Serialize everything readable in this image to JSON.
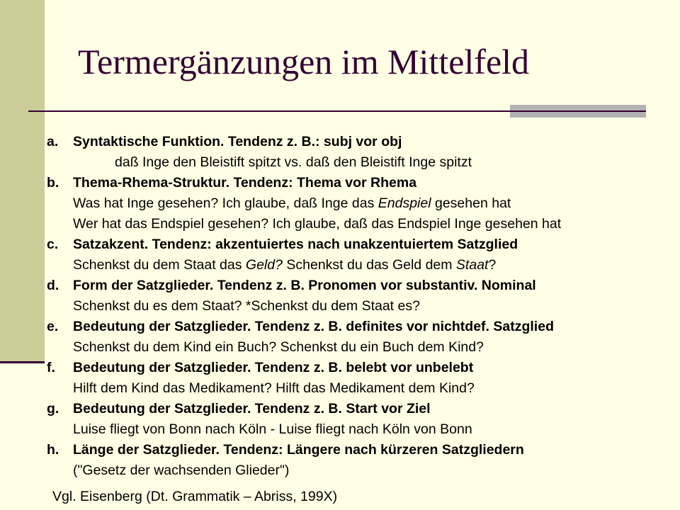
{
  "title": "Termergänzungen im Mittelfeld",
  "items": [
    {
      "letter": "a.",
      "heading": "Syntaktische Funktion. Tendenz z. B.: subj vor obj",
      "examples": [
        {
          "text": "daß Inge den Bleistift spitzt vs. daß den Bleistift Inge spitzt",
          "indent": "deep"
        }
      ]
    },
    {
      "letter": "b.",
      "heading": "Thema-Rhema-Struktur. Tendenz: Thema vor Rhema",
      "examples": [
        {
          "text": "Was hat Inge gesehen? Ich glaube, daß Inge das ",
          "em": "Endspiel",
          "after": " gesehen hat"
        },
        {
          "text": "Wer hat das Endspiel gesehen? Ich glaube, daß das Endspiel Inge gesehen hat"
        }
      ]
    },
    {
      "letter": "c.",
      "heading": "Satzakzent. Tendenz: akzentuiertes nach unakzentuiertem Satzglied",
      "examples": [
        {
          "text": "Schenkst du dem Staat das ",
          "em": "Geld?",
          "after": " Schenkst du das Geld dem ",
          "em2": "Staat",
          "after2": "?"
        }
      ]
    },
    {
      "letter": "d.",
      "heading": "Form der Satzglieder. Tendenz z. B. Pronomen vor substantiv. Nominal",
      "examples": [
        {
          "text": "Schenkst du es dem Staat? *Schenkst du dem Staat es?"
        }
      ]
    },
    {
      "letter": "e.",
      "heading": "Bedeutung der Satzglieder. Tendenz z. B. definites vor nichtdef. Satzglied",
      "examples": [
        {
          "text": "Schenkst du dem Kind ein Buch? Schenkst du ein Buch dem Kind?"
        }
      ]
    },
    {
      "letter": "f.",
      "heading": "Bedeutung der Satzglieder. Tendenz z. B. belebt vor unbelebt",
      "examples": [
        {
          "text": "Hilft dem Kind das Medikament? Hilft das Medikament dem Kind?"
        }
      ]
    },
    {
      "letter": "g.",
      "heading": "Bedeutung der Satzglieder. Tendenz z. B. Start vor Ziel",
      "examples": [
        {
          "text": "Luise fliegt von Bonn nach Köln - Luise fliegt nach Köln von Bonn"
        }
      ]
    },
    {
      "letter": "h.",
      "heading": "Länge der Satzglieder. Tendenz: Längere nach kürzeren Satzgliedern",
      "examples": [
        {
          "text": "(\"Gesetz der wachsenden Glieder\")"
        }
      ]
    }
  ],
  "footer": "Vgl. Eisenberg (Dt. Grammatik – Abriss, 199X)"
}
